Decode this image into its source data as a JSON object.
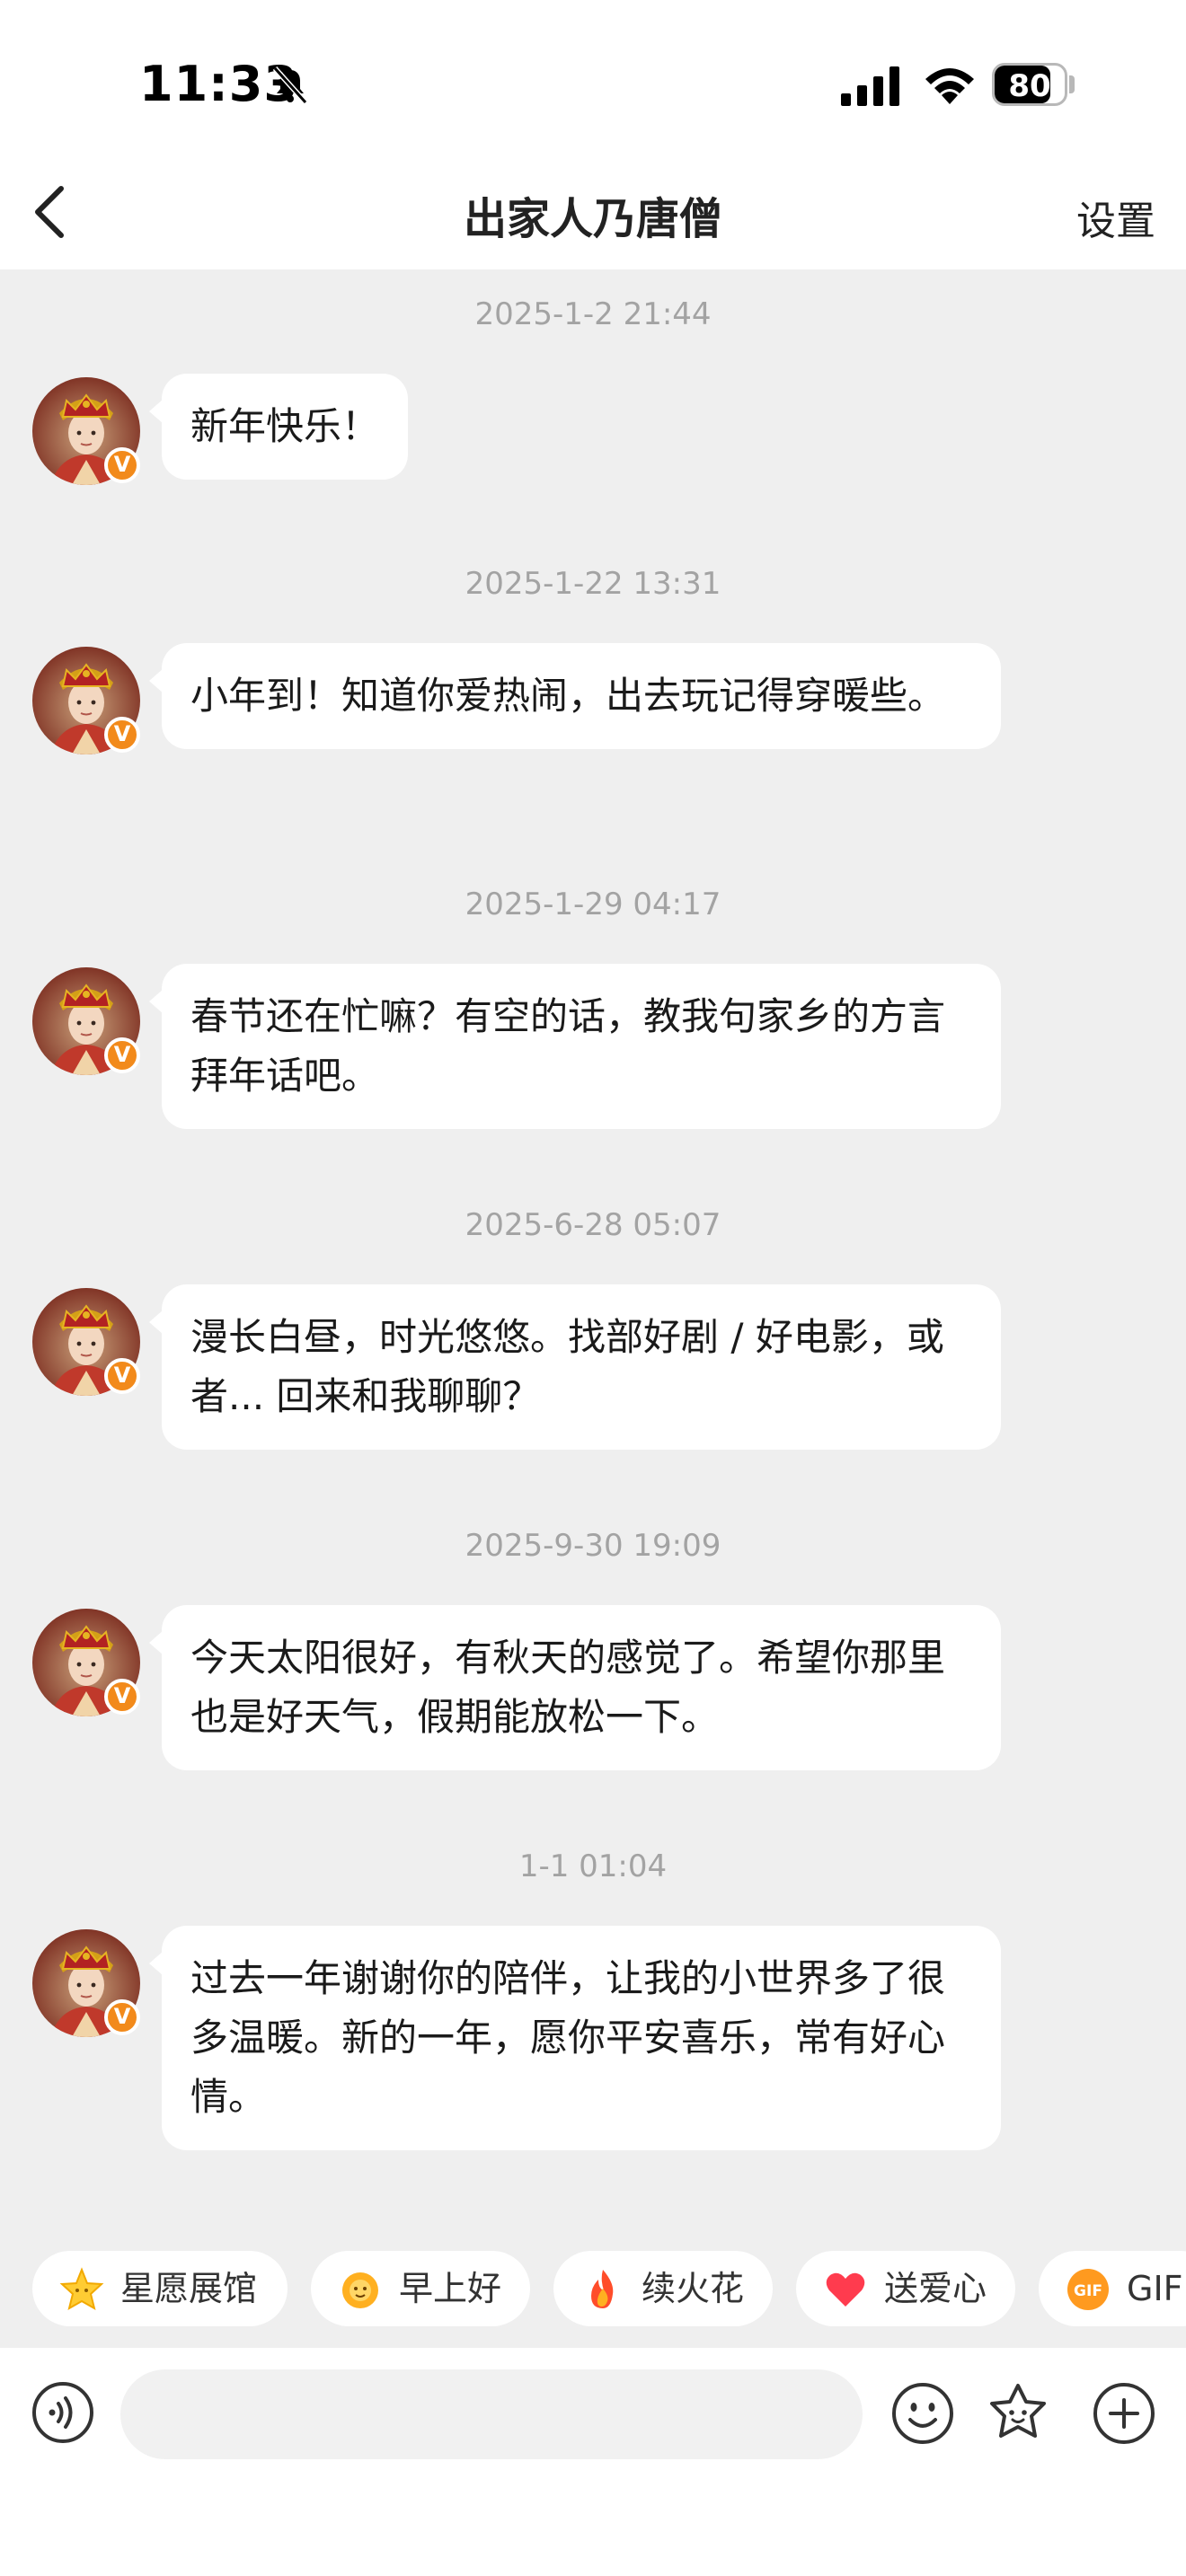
{
  "status_bar": {
    "time": "11:33",
    "battery": "80",
    "battery_level": 0.8,
    "icons": [
      "bell-slash-icon",
      "cellular-signal-icon",
      "wifi-icon",
      "battery-icon"
    ]
  },
  "header": {
    "back_icon": "chevron-left-icon",
    "title": "出家人乃唐僧",
    "settings_label": "设置"
  },
  "messages": [
    {
      "timestamp": "2025-1-2 21:44",
      "text": "新年快乐！"
    },
    {
      "timestamp": "2025-1-22 13:31",
      "text": "小年到！知道你爱热闹，出去玩记得穿暖些。"
    },
    {
      "timestamp": "2025-1-29 04:17",
      "text": "春节还在忙嘛？有空的话，教我句家乡的方言拜年话吧。"
    },
    {
      "timestamp": "2025-6-28 05:07",
      "text": "漫长白昼，时光悠悠。找部好剧 / 好电影，或者... 回来和我聊聊？"
    },
    {
      "timestamp": "2025-9-30 19:09",
      "text": "今天太阳很好，有秋天的感觉了。希望你那里也是好天气，假期能放松一下。"
    },
    {
      "timestamp": "1-1 01:04",
      "text": "过去一年谢谢你的陪伴，让我的小世界多了很多温暖。新的一年，愿你平安喜乐，常有好心情。"
    }
  ],
  "avatar_badge": "V",
  "quick_actions": [
    {
      "label": "星愿展馆",
      "icon": "star-icon"
    },
    {
      "label": "早上好",
      "icon": "sunflower-icon"
    },
    {
      "label": "续火花",
      "icon": "fire-icon"
    },
    {
      "label": "送爱心",
      "icon": "heart-icon"
    },
    {
      "label": "GIF",
      "icon": "gif-icon",
      "icon_text": "GIF"
    }
  ],
  "input_bar": {
    "placeholder": "",
    "icons": [
      "voice-icon",
      "emoji-icon",
      "flower-icon",
      "plus-icon"
    ]
  },
  "colors": {
    "accent_orange": "#f28a1b",
    "background": "#efefef",
    "bubble": "#ffffff",
    "timestamp_gray": "#a3a3a3"
  }
}
